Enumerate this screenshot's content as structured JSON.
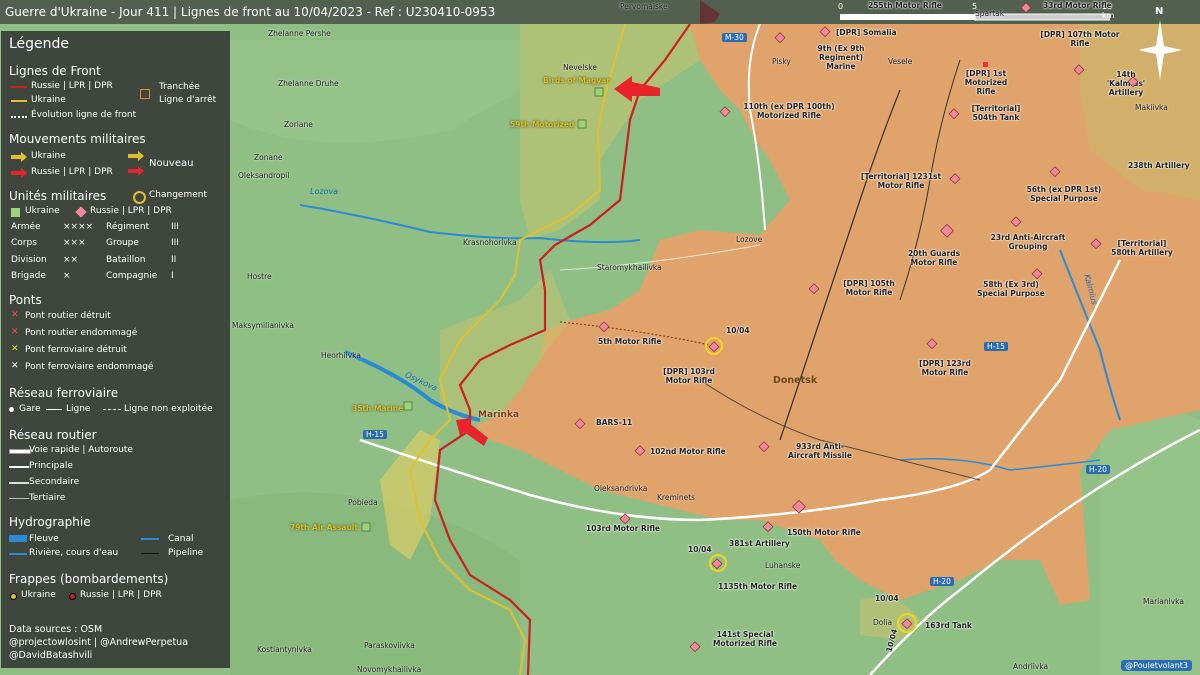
{
  "title": "Guerre d'Ukraine - Jour 411 | Lignes de front au 10/04/2023 - Ref : U230410-0953",
  "scale": {
    "zero": "0",
    "mid": "5",
    "end": "10 km"
  },
  "north": "N",
  "handle": "@Pouletvolant3",
  "colors": {
    "russia_zone": "#e8a068",
    "contested": "#c7c36e",
    "russia_line": "#cc1f1f",
    "ukraine_line": "#e0c031",
    "terrain": "#8fbf84",
    "river": "#2b8ad4"
  },
  "legend": {
    "title": "Légende",
    "front": {
      "title": "Lignes de Front",
      "russia": "Russie | LPR | DPR",
      "ukraine": "Ukraine",
      "evolution": "Évolution ligne de front",
      "trench": "Tranchée",
      "stopline": "Ligne d'arrêt"
    },
    "movements": {
      "title": "Mouvements militaires",
      "ukraine": "Ukraine",
      "russia": "Russie | LPR | DPR",
      "new": "Nouveau"
    },
    "units": {
      "title": "Unités militaires",
      "change": "Changement",
      "ukraine": "Ukraine",
      "russia": "Russie | LPR | DPR",
      "rows": [
        {
          "a": "Armée",
          "as": "××××",
          "b": "Régiment",
          "bs": "III"
        },
        {
          "a": "Corps",
          "as": "×××",
          "b": "Groupe",
          "bs": "III"
        },
        {
          "a": "Division",
          "as": "××",
          "b": "Bataillon",
          "bs": "II"
        },
        {
          "a": "Brigade",
          "as": "×",
          "b": "Compagnie",
          "bs": "I"
        }
      ]
    },
    "bridges": {
      "title": "Ponts",
      "items": [
        "Pont routier détruit",
        "Pont routier endommagé",
        "Pont ferroviaire détruit",
        "Pont ferroviaire endommagé"
      ]
    },
    "rail": {
      "title": "Réseau ferroviaire",
      "station": "Gare",
      "line": "Ligne",
      "unused": "Ligne non exploitée"
    },
    "roads": {
      "title": "Réseau routier",
      "items": [
        "Voie rapide | Autoroute",
        "Principale",
        "Secondaire",
        "Tertiaire"
      ]
    },
    "hydro": {
      "title": "Hydrographie",
      "river": "Fleuve",
      "canal": "Canal",
      "stream": "Rivière, cours d'eau",
      "pipeline": "Pipeline"
    },
    "strikes": {
      "title": "Frappes (bombardements)",
      "ukraine": "Ukraine",
      "russia": "Russie | LPR | DPR"
    }
  },
  "sources": [
    "Data sources : OSM",
    "@projectowlosint | @AndrewPerpetua",
    "@DavidBatashvili"
  ],
  "towns": [
    "Pervomaiske",
    "Nevelske",
    "Pisky",
    "Vesele",
    "Spartak",
    "Zhelanne Pershe",
    "Zhelanne Druhe",
    "Zoriane",
    "Zonane",
    "Oleksandropil",
    "Krasnohorivka",
    "Staromykhailivka",
    "Lozove",
    "Hostre",
    "Maksymilianivka",
    "Heorhiivka",
    "Marinka",
    "Oleksandrivka",
    "Kreminets",
    "Pobieda",
    "Luhanske",
    "Makiivka",
    "Kostiantynivka",
    "Paraskoviivka",
    "Novomykhailivka",
    "Dolia",
    "Andriivka",
    "Marianivka"
  ],
  "city": "Donetsk",
  "rivers": [
    "Lozova",
    "Osykova",
    "Kalmius"
  ],
  "roads": [
    "M-30",
    "H-15",
    "H-15",
    "H-20",
    "H-20"
  ],
  "units_ru": [
    "255th Motor Rifle",
    "33rd Motor Rifle",
    "[DPR] Somalia",
    "9th (Ex 9th Regiment) Marine",
    "[DPR] 107th Motor Rifle",
    "[DPR] 1st Motorized Rifle",
    "14th 'Kalmius' Artillery",
    "110th (ex DPR 100th) Motorized Rifle",
    "[Territorial] 504th Tank",
    "238th Artillery",
    "[Territorial] 1231st Motor Rifle",
    "56th (ex DPR 1st) Special Purpose",
    "23rd Anti-Aircraft Grouping",
    "20th Guards Motor Rifle",
    "[Territorial] 580th Artillery",
    "58th (Ex 3rd) Special Purpose",
    "[DPR] 105th Motor Rifle",
    "5th Motor Rifle",
    "[DPR] 103rd Motor Rifle",
    "[DPR] 123rd Motor Rifle",
    "BARS-11",
    "102nd Motor Rifle",
    "933rd Anti-Aircraft Missile",
    "103rd Motor Rifle",
    "381st Artillery",
    "150th Motor Rifle",
    "1135th Motor Rifle",
    "141st Special Motorized Rifle",
    "163rd Tank"
  ],
  "units_ua": [
    "Birds of Magyar",
    "59th Motorized",
    "35th Marine",
    "79th Air Assault"
  ],
  "dates": [
    "10/04",
    "10/04",
    "10/04",
    "10/04"
  ]
}
